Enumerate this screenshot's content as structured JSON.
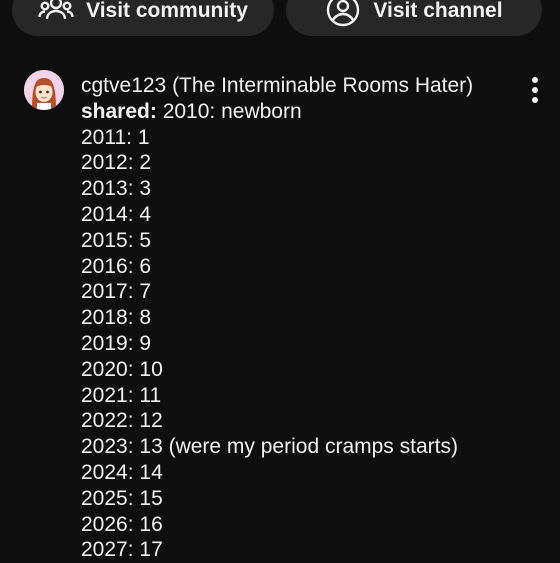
{
  "top_buttons": {
    "community_label": "Visit community",
    "community_icon": "people-icon",
    "channel_label": "Visit channel",
    "channel_icon": "account-icon"
  },
  "comment": {
    "author": "cgtve123 (The Interminable Rooms Hater)",
    "shared_label": "shared:",
    "first_line": " 2010: newborn",
    "lines": [
      "2011: 1",
      "2012: 2",
      "2013: 3",
      "2014: 4",
      "2015: 5",
      "2016: 6",
      "2017: 7",
      "2018: 8",
      "2019: 9",
      "2020: 10",
      "2021: 11",
      "2022: 12",
      "2023: 13 (were my period cramps starts)",
      "2024: 14",
      "2025: 15",
      "2026: 16",
      "2027: 17"
    ],
    "menu_icon": "more-vertical-icon"
  },
  "colors": {
    "background": "#0f0f0f",
    "pill": "#272727",
    "text": "#f1f1f1",
    "avatar_bg": "#f4d3e7"
  }
}
